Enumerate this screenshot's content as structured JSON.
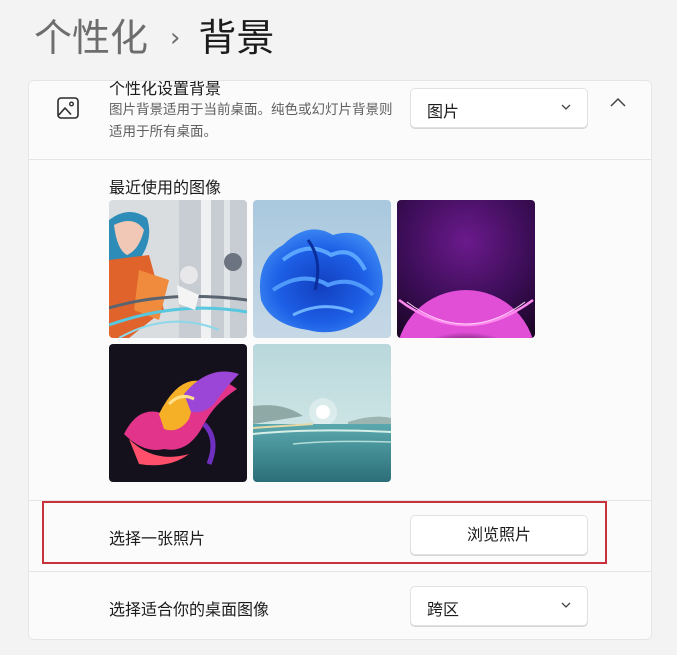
{
  "breadcrumb": {
    "parent": "个性化",
    "separator": "›",
    "current": "背景"
  },
  "background_setting": {
    "title": "个性化设置背景",
    "description": "图片背景适用于当前桌面。纯色或幻灯片背景则适用于所有桌面。",
    "selected_type": "图片",
    "icon": "picture-icon",
    "collapse_icon": "chevron-up-icon"
  },
  "recent_images": {
    "label": "最近使用的图像",
    "items": [
      "anime-artwork",
      "blue-bloom",
      "purple-glow",
      "colorful-ribbon",
      "lake-landscape"
    ]
  },
  "choose_photo": {
    "label": "选择一张照片",
    "button_label": "浏览照片"
  },
  "fit": {
    "label": "选择适合你的桌面图像",
    "selected_value": "跨区"
  },
  "colors": {
    "highlight": "#c8323c",
    "panel": "#fbfbfb",
    "background": "#f3f3f3"
  }
}
